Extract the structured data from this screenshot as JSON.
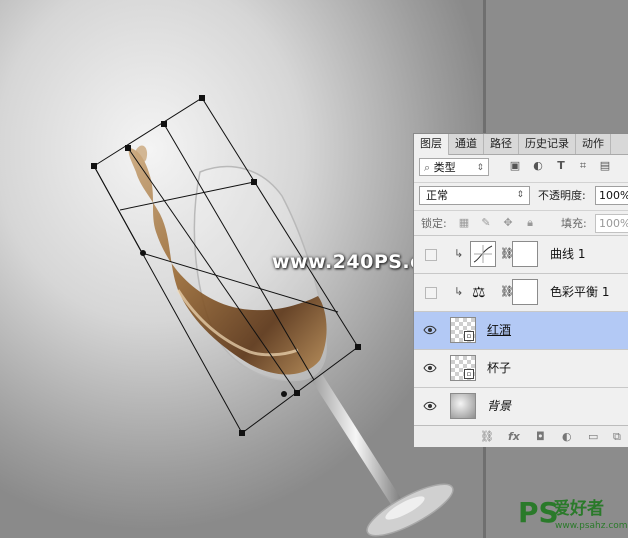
{
  "panel": {
    "tabs": [
      "图层",
      "通道",
      "路径",
      "历史记录",
      "动作"
    ],
    "filter": {
      "label": "类型",
      "icons": [
        "image-filter-icon",
        "adjustment-filter-icon",
        "type-filter-icon",
        "shape-filter-icon",
        "smart-object-filter-icon"
      ]
    },
    "blend_mode": "正常",
    "opacity_label": "不透明度:",
    "opacity_value": "100%",
    "lock_label": "锁定:",
    "fill_label": "填充:",
    "fill_value": "100%",
    "layers": [
      {
        "name": "曲线 1",
        "type": "adjustment",
        "icon": "curves-icon",
        "visible": false
      },
      {
        "name": "色彩平衡 1",
        "type": "adjustment",
        "icon": "color-balance-icon",
        "visible": false
      },
      {
        "name": "红酒",
        "type": "pixel",
        "visible": true,
        "selected": true
      },
      {
        "name": "杯子",
        "type": "pixel",
        "visible": true
      },
      {
        "name": "背景",
        "type": "background",
        "visible": true
      }
    ],
    "bottom_icons": [
      "link-layers-icon",
      "fx-icon",
      "add-mask-icon",
      "new-adjustment-icon",
      "new-group-icon",
      "new-layer-icon"
    ]
  },
  "watermark": "www.240PS.com",
  "logo": {
    "ps": "PS",
    "cn": "爱好者",
    "url": "www.psahz.com"
  },
  "colors": {
    "selected_row": "#b3c9f5",
    "panel_bg": "#f0f0f0",
    "logo_green": "#2a7a2a"
  }
}
